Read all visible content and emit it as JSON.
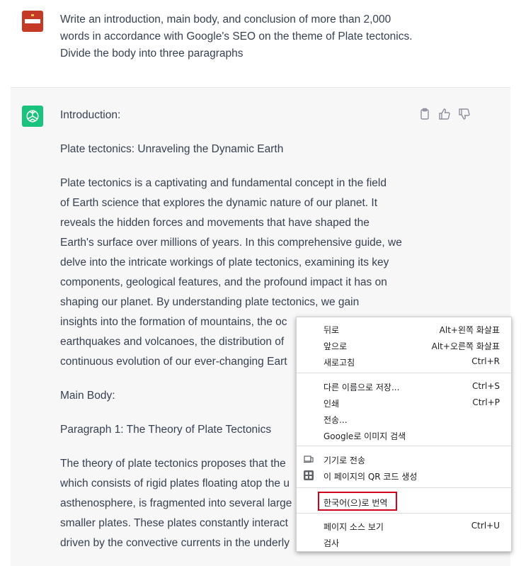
{
  "user": {
    "prompt": "Write an introduction, main body, and conclusion of more than 2,000 words in accordance with Google's SEO on the theme of Plate tectonics. Divide the body into three paragraphs"
  },
  "assistant": {
    "lines": [
      "Introduction:",
      "Plate tectonics: Unraveling the Dynamic Earth",
      "Plate tectonics is a captivating and fundamental concept in the field",
      "of Earth science that explores the dynamic nature of our planet. It",
      "reveals the hidden forces and movements that have shaped the",
      "Earth's surface over millions of years. In this comprehensive guide, we",
      "delve into the intricate workings of plate tectonics, examining its key",
      "components, geological features, and the profound impact it has on",
      "shaping our planet. By understanding plate tectonics, we gain",
      "insights into the formation of mountains, the oc",
      "earthquakes and volcanoes, the distribution of",
      "continuous evolution of our ever-changing Eart",
      "Main Body:",
      "Paragraph 1: The Theory of Plate Tectonics",
      "The theory of plate tectonics proposes that the",
      "which consists of rigid plates floating atop the u",
      "asthenosphere, is fragmented into several large",
      "smaller plates. These plates constantly interact",
      "driven by the convective currents in the underly"
    ]
  },
  "context_menu": {
    "items": [
      {
        "label": "뒤로",
        "shortcut": "Alt+왼쪽 화살표"
      },
      {
        "label": "앞으로",
        "shortcut": "Alt+오른쪽 화살표"
      },
      {
        "label": "새로고침",
        "shortcut": "Ctrl+R"
      },
      {
        "label": "다른 이름으로 저장...",
        "shortcut": "Ctrl+S"
      },
      {
        "label": "인쇄",
        "shortcut": "Ctrl+P"
      },
      {
        "label": "전송...",
        "shortcut": ""
      },
      {
        "label": "Google로 이미지 검색",
        "shortcut": ""
      },
      {
        "label": "기기로 전송",
        "shortcut": ""
      },
      {
        "label": "이 페이지의 QR 코드 생성",
        "shortcut": ""
      },
      {
        "label": "한국어(으)로 번역",
        "shortcut": ""
      },
      {
        "label": "페이지 소스 보기",
        "shortcut": "Ctrl+U"
      },
      {
        "label": "검사",
        "shortcut": ""
      }
    ]
  },
  "colors": {
    "user_avatar": "#c53a26",
    "gpt_avatar": "#19c37d",
    "highlight_box": "#d0021b"
  }
}
